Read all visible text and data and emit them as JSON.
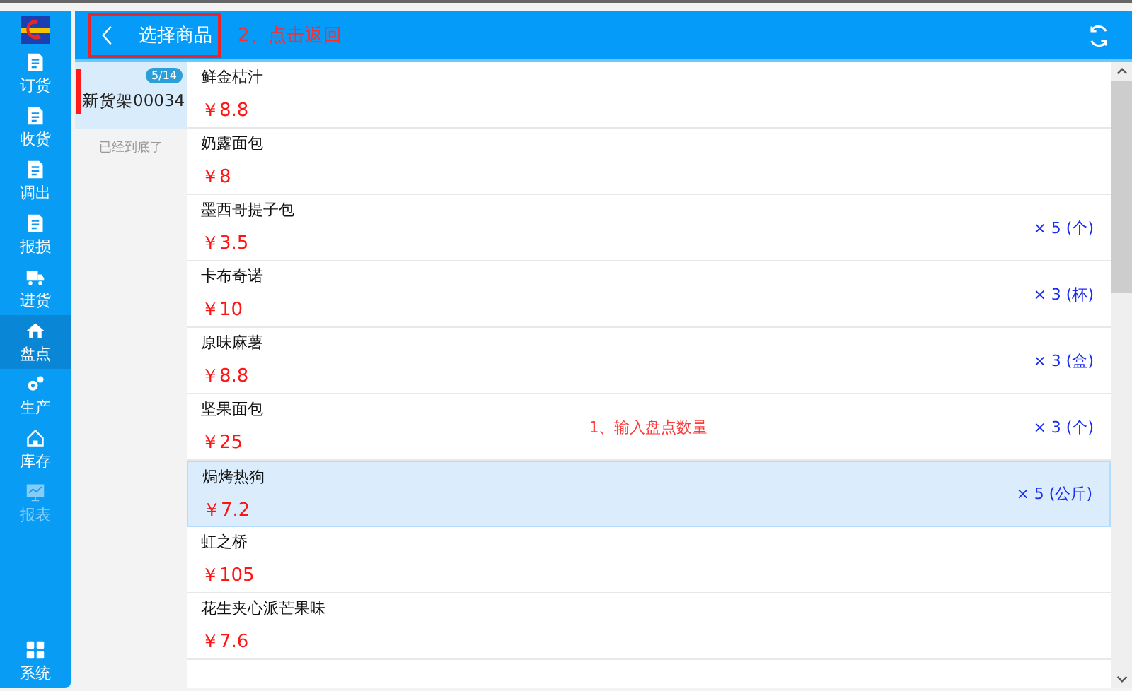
{
  "nav": {
    "items": [
      {
        "label": "订货",
        "selected": false,
        "disabled": false
      },
      {
        "label": "收货",
        "selected": false,
        "disabled": false
      },
      {
        "label": "调出",
        "selected": false,
        "disabled": false
      },
      {
        "label": "报损",
        "selected": false,
        "disabled": false
      },
      {
        "label": "进货",
        "selected": false,
        "disabled": false
      },
      {
        "label": "盘点",
        "selected": true,
        "disabled": false
      },
      {
        "label": "生产",
        "selected": false,
        "disabled": false
      },
      {
        "label": "库存",
        "selected": false,
        "disabled": false
      },
      {
        "label": "报表",
        "selected": false,
        "disabled": true
      }
    ],
    "bottom_item": {
      "label": "系统"
    }
  },
  "header": {
    "title": "选择商品",
    "annotation": "2、点击返回"
  },
  "categories": [
    {
      "name": "新货架00034",
      "badge": "5/14",
      "selected": true
    }
  ],
  "category_footer": "已经到底了",
  "annotation": "1、输入盘点数量",
  "products": [
    {
      "name": "鲜金桔汁",
      "price": "￥8.8",
      "selected": false
    },
    {
      "name": "奶露面包",
      "price": "￥8",
      "selected": false
    },
    {
      "name": "墨西哥提子包",
      "price": "￥3.5",
      "quantity": "× 5 (个)",
      "selected": false
    },
    {
      "name": "卡布奇诺",
      "price": "￥10",
      "quantity": "× 3 (杯)",
      "selected": false
    },
    {
      "name": "原味麻薯",
      "price": "￥8.8",
      "quantity": "× 3 (盒)",
      "selected": false
    },
    {
      "name": "坚果面包",
      "price": "￥25",
      "quantity": "× 3 (个)",
      "selected": false
    },
    {
      "name": "焗烤热狗",
      "price": "￥7.2",
      "quantity": "× 5 (公斤)",
      "selected": true
    },
    {
      "name": "虹之桥",
      "price": "￥105",
      "selected": false
    },
    {
      "name": "花生夹心派芒果味",
      "price": "￥7.6",
      "selected": false
    }
  ]
}
